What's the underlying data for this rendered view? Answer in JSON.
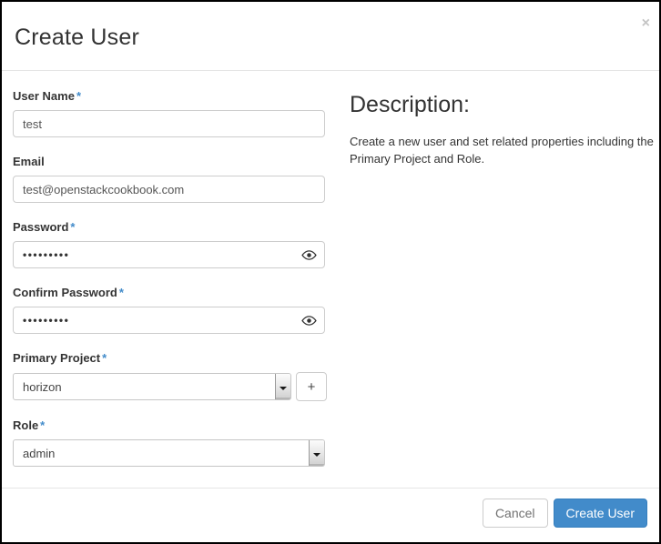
{
  "modal": {
    "title": "Create User",
    "close_label": "×"
  },
  "form": {
    "required_marker": "*",
    "fields": [
      {
        "label": "User Name",
        "required": true,
        "type": "text",
        "value": "test"
      },
      {
        "label": "Email",
        "required": false,
        "type": "text",
        "value": "test@openstackcookbook.com"
      },
      {
        "label": "Password",
        "required": true,
        "type": "password",
        "value": "•••••••••"
      },
      {
        "label": "Confirm Password",
        "required": true,
        "type": "password",
        "value": "•••••••••"
      },
      {
        "label": "Primary Project",
        "required": true,
        "type": "select",
        "value": "horizon"
      },
      {
        "label": "Role",
        "required": true,
        "type": "select",
        "value": "admin"
      }
    ],
    "add_project_label": "+"
  },
  "description": {
    "heading": "Description:",
    "body": "Create a new user and set related properties including the Primary Project and Role."
  },
  "footer": {
    "cancel_label": "Cancel",
    "submit_label": "Create User"
  },
  "colors": {
    "primary_button": "#428bca",
    "primary_button_border": "#357ebd",
    "required_marker": "#428bca",
    "divider": "#e5e5e5",
    "input_border": "#cccccc",
    "text": "#333333"
  },
  "icons": {
    "close": "close-icon",
    "password_reveal": "eye-icon",
    "description_info": "eye-icon",
    "select_dropdown": "chevron-down-icon",
    "add_project": "plus-icon"
  }
}
